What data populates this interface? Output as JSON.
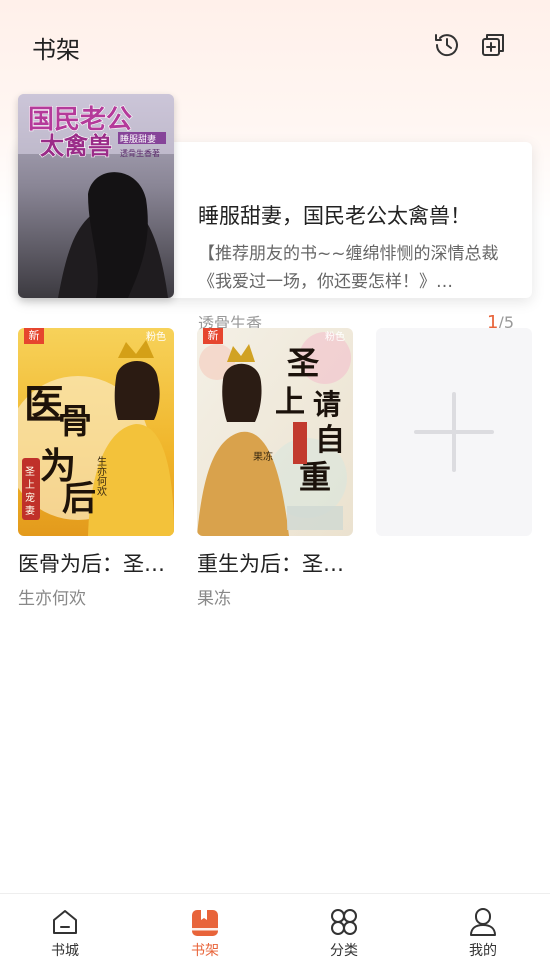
{
  "header": {
    "title": "书架",
    "history_icon": "history-clock-icon",
    "import_icon": "add-book-stack-icon"
  },
  "featured": {
    "cover_text": {
      "line1": "国民老公",
      "line2": "太禽兽",
      "tag": "睡服甜妻",
      "author_mark": "透骨生香著"
    },
    "title": "睡服甜妻，国民老公太禽兽！",
    "description": "【推荐朋友的书~~缠绵悱恻的深情总裁《我爱过一场，你还要怎样！》…",
    "author": "透骨生香",
    "progress_current": "1",
    "progress_total": "/5"
  },
  "books": [
    {
      "title": "医骨为后：圣…",
      "author": "生亦何欢",
      "badge": "新",
      "tag": "粉色",
      "cover_text": {
        "big": "医骨为后",
        "small": "生亦何欢"
      }
    },
    {
      "title": "重生为后：圣…",
      "author": "果冻",
      "badge": "新",
      "tag": "粉色",
      "cover_text": {
        "big": "圣上请自重",
        "small": "果冻"
      }
    }
  ],
  "add_tile": {
    "icon": "plus-icon"
  },
  "tabs": [
    {
      "label": "书城",
      "icon": "home-icon"
    },
    {
      "label": "书架",
      "icon": "bookshelf-icon",
      "active": true
    },
    {
      "label": "分类",
      "icon": "category-grid-icon"
    },
    {
      "label": "我的",
      "icon": "profile-icon"
    }
  ],
  "colors": {
    "accent": "#e8643a",
    "header_bg": "#fff0ea"
  }
}
